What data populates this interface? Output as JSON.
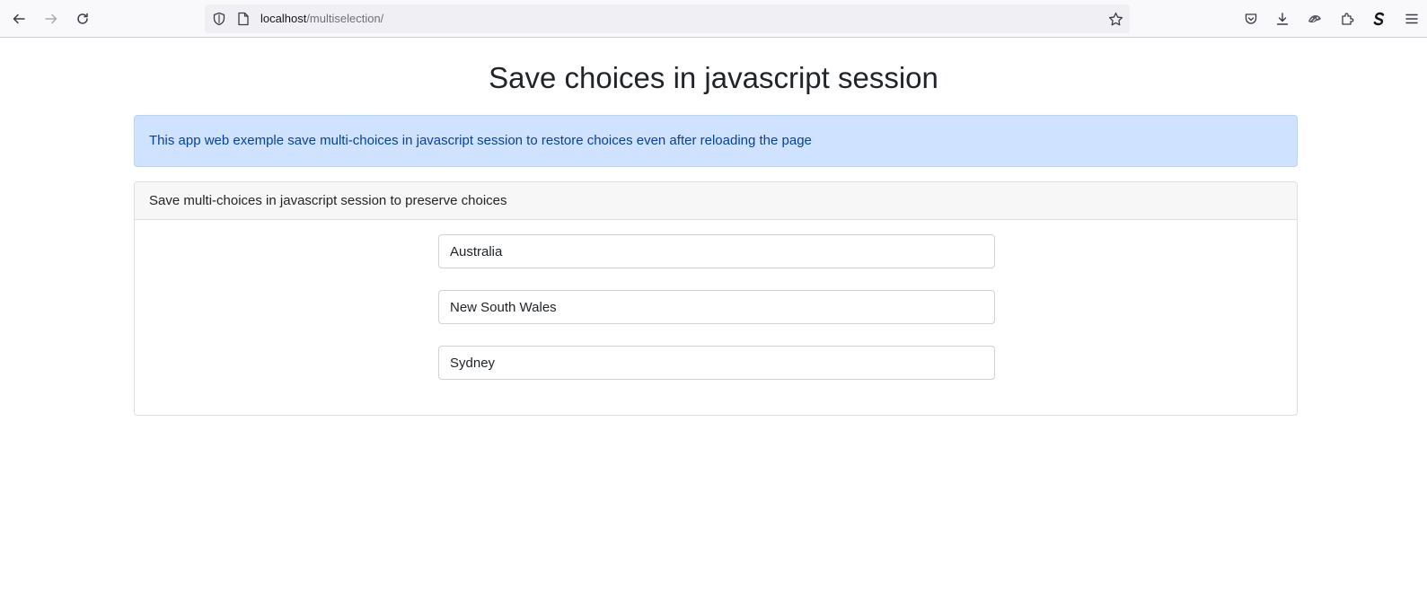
{
  "browser": {
    "url_host": "localhost",
    "url_path": "/multiselection/"
  },
  "page": {
    "title": "Save choices in javascript session",
    "alert_text": "This app web exemple save multi-choices in javascript session to restore choices even after reloading the page",
    "card": {
      "header": "Save multi-choices in javascript session to preserve choices",
      "fields": [
        {
          "value": "Australia"
        },
        {
          "value": "New South Wales"
        },
        {
          "value": "Sydney"
        }
      ]
    }
  },
  "icons": {
    "back": "back-arrow-icon",
    "forward": "forward-arrow-icon",
    "reload": "reload-icon",
    "shield": "tracking-protection-shield-icon",
    "page": "page-info-icon",
    "bookmark": "bookmark-star-icon",
    "pocket": "pocket-icon",
    "downloads": "download-icon",
    "extension_1": "extension-icon",
    "extensions": "puzzle-extensions-icon",
    "extension_s": "s-extension-icon",
    "menu": "hamburger-menu-icon"
  },
  "colors": {
    "alert_bg": "#cfe2ff",
    "alert_text": "#084298",
    "card_header_bg": "#f7f7f7"
  }
}
